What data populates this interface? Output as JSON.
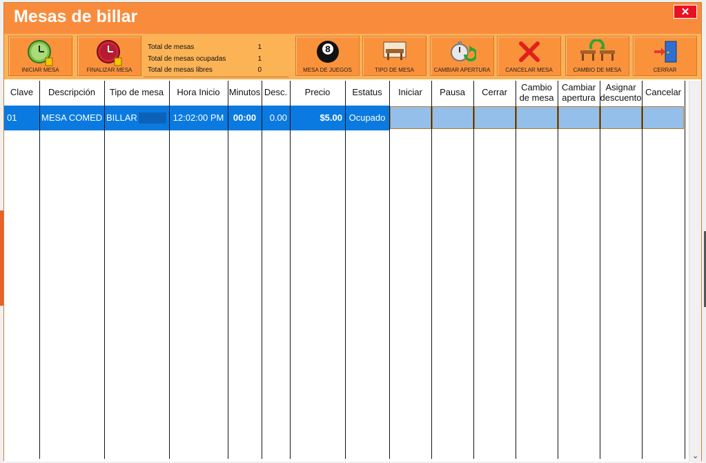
{
  "window": {
    "title": "Mesas de billar",
    "close_symbol": "✕"
  },
  "toolbar": {
    "iniciar_mesa": "INICIAR MESA",
    "finalizar_mesa": "FINALIZAR MESA",
    "mesa_de_juegos": "MESA DE JUEGOS",
    "tipo_de_mesa": "TIPO DE MESA",
    "cambiar_apertura": "CAMBIAR APERTURA",
    "cancelar_mesa": "CANCELAR MESA",
    "cambio_de_mesa": "CAMBIO DE MESA",
    "cerrar": "CERRAR"
  },
  "stats": [
    {
      "label": "Total de mesas",
      "value": "1"
    },
    {
      "label": "Total de mesas ocupadas",
      "value": "1"
    },
    {
      "label": "Total de mesas libres",
      "value": "0"
    }
  ],
  "columns": [
    "Clave",
    "Descripción",
    "Tipo de mesa",
    "Hora Inicio",
    "Minutos",
    "Desc.",
    "Precio",
    "Estatus",
    "Iniciar",
    "Pausa",
    "Cerrar",
    "Cambio de mesa",
    "Cambiar apertura",
    "Asignar descuento",
    "Cancelar"
  ],
  "rows": [
    {
      "clave": "01",
      "descripcion": "MESA COMED",
      "tipo": "BILLAR",
      "hora_inicio": "12:02:00 PM",
      "minutos": "00:00",
      "desc": "0.00",
      "precio": "$5.00",
      "estatus": "Ocupado"
    }
  ],
  "icons": {
    "iniciar": "clock-green-icon",
    "finalizar": "clock-red-icon",
    "mesa_juegos": "eight-ball-icon",
    "tipo_mesa": "table-icon",
    "cambiar_apertura": "stopwatch-refresh-icon",
    "cancelar": "red-x-icon",
    "cambio_mesa": "tables-swap-icon",
    "cerrar": "exit-door-icon"
  },
  "colors": {
    "title_bar": "#f98c3c",
    "toolbar": "#fbb356",
    "selected_row": "#0a7ae0",
    "action_cell": "#94bfea"
  }
}
